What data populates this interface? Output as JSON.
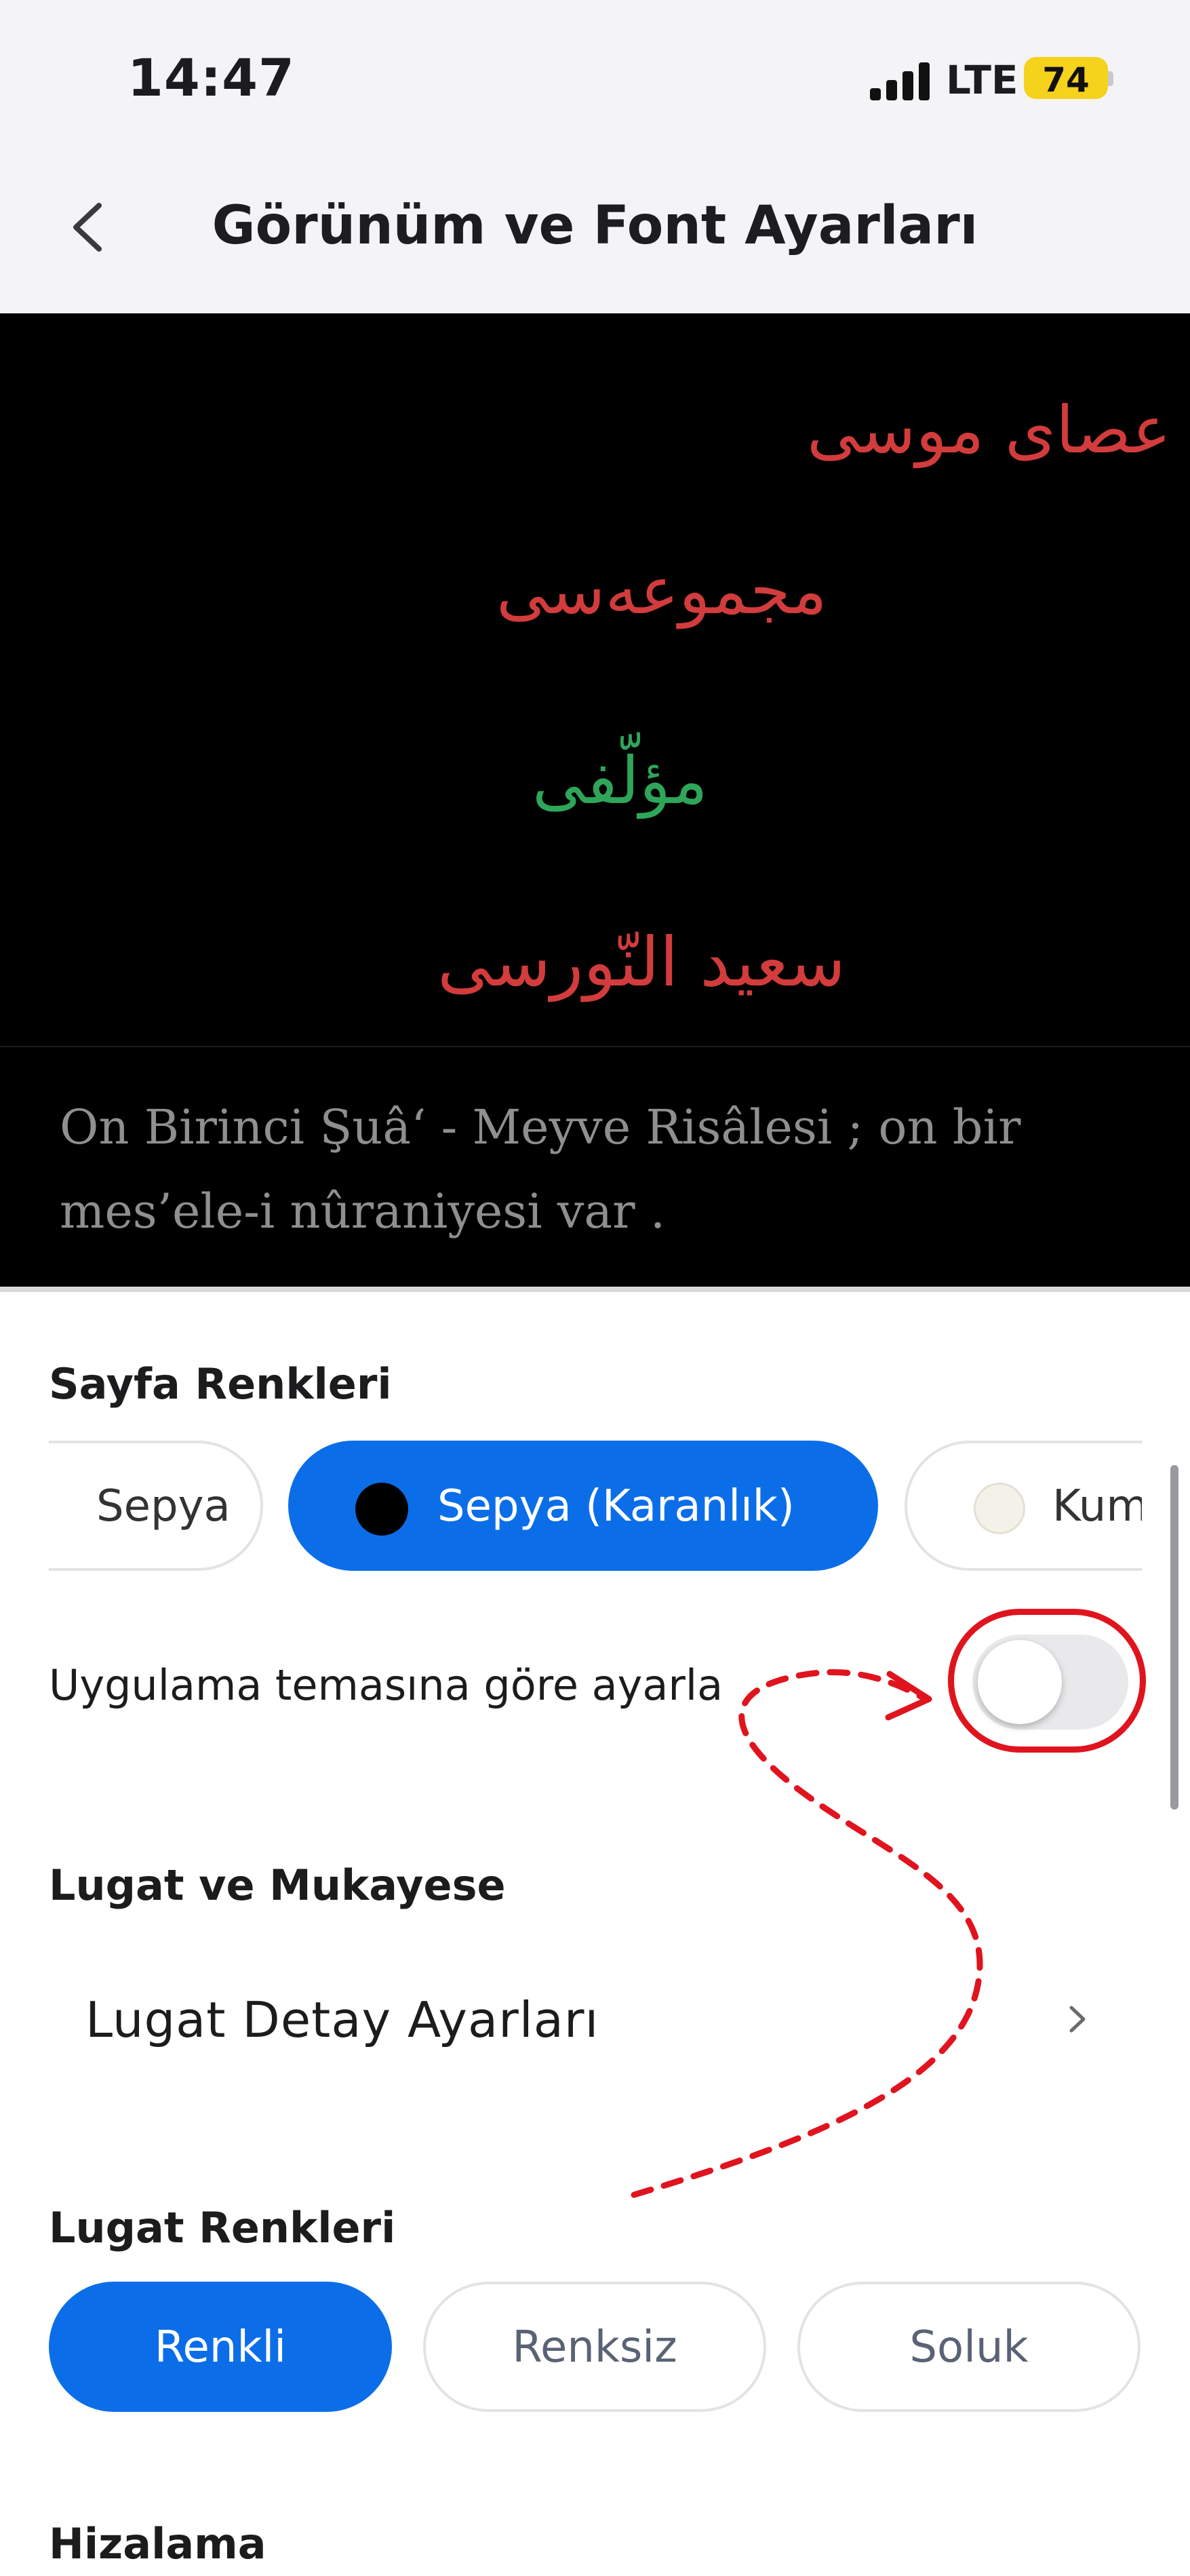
{
  "status_bar": {
    "time": "14:47",
    "network": "LTE",
    "battery": "74",
    "battery_color": "#f5d21b"
  },
  "nav": {
    "title": "Görünüm ve Font Ayarları",
    "back_icon": "chevron-left-icon"
  },
  "preview": {
    "arabic_lines": [
      "عصاى موسى",
      "مجموعەسى",
      "مؤلّفى",
      "سعيد النّورسى"
    ],
    "text": "On Birinci Şuâ‘ - Meyve Risâlesi ; on bir mes’ele-i nûraniyesi var ."
  },
  "page_colors": {
    "title": "Sayfa Renkleri",
    "options": [
      {
        "label": "Sepya",
        "selected": false
      },
      {
        "label": "Sepya (Karanlık)",
        "selected": true,
        "swatch": "#000000"
      },
      {
        "label": "Kum",
        "selected": false,
        "swatch": "#f4f1e8"
      }
    ],
    "selected_color": "#0b6ee8"
  },
  "theme_toggle": {
    "label": "Uygulama temasına göre ayarla",
    "on": false
  },
  "dictionary": {
    "title": "Lugat ve Mukayese",
    "detail_settings": "Lugat Detay Ayarları"
  },
  "dictionary_colors": {
    "title": "Lugat Renkleri",
    "options": [
      {
        "label": "Renkli",
        "selected": true
      },
      {
        "label": "Renksiz",
        "selected": false
      },
      {
        "label": "Soluk",
        "selected": false
      }
    ]
  },
  "alignment": {
    "title": "Hizalama"
  },
  "annotation_color": "#e0141e"
}
